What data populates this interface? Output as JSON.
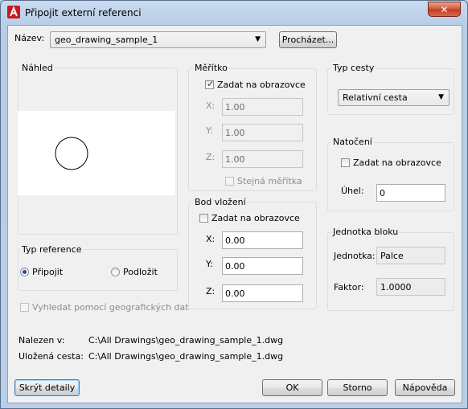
{
  "window": {
    "title": "Připojit externí referenci"
  },
  "name_row": {
    "label": "Název:",
    "value": "geo_drawing_sample_1",
    "browse_label": "Procházet..."
  },
  "preview": {
    "label": "Náhled"
  },
  "reference_type": {
    "label": "Typ reference",
    "attach_label": "Připojit",
    "overlay_label": "Podložit",
    "attach_selected": true
  },
  "geo_locate": {
    "label": "Vyhledat pomocí geografických dat",
    "checked": false
  },
  "scale": {
    "label": "Měřítko",
    "specify_label": "Zadat na obrazovce",
    "specify_checked": true,
    "x_label": "X:",
    "x_value": "1.00",
    "y_label": "Y:",
    "y_value": "1.00",
    "z_label": "Z:",
    "z_value": "1.00",
    "uniform_label": "Stejná měřítka",
    "uniform_checked": false
  },
  "insertion": {
    "label": "Bod vložení",
    "specify_label": "Zadat na obrazovce",
    "specify_checked": false,
    "x_label": "X:",
    "x_value": "0.00",
    "y_label": "Y:",
    "y_value": "0.00",
    "z_label": "Z:",
    "z_value": "0.00"
  },
  "path_type": {
    "label": "Typ cesty",
    "value": "Relativní cesta"
  },
  "rotation": {
    "label": "Natočení",
    "specify_label": "Zadat na obrazovce",
    "specify_checked": false,
    "angle_label": "Úhel:",
    "angle_value": "0"
  },
  "block_unit": {
    "label": "Jednotka bloku",
    "unit_label": "Jednotka:",
    "unit_value": "Palce",
    "factor_label": "Faktor:",
    "factor_value": "1.0000"
  },
  "details": {
    "found_label": "Nalezen v:",
    "found_value": "C:\\All Drawings\\geo_drawing_sample_1.dwg",
    "saved_label": "Uložená cesta:",
    "saved_value": "C:\\All Drawings\\geo_drawing_sample_1.dwg"
  },
  "buttons": {
    "hide_details": "Skrýt detaily",
    "ok": "OK",
    "cancel": "Storno",
    "help": "Nápověda"
  },
  "colors": {
    "title_bar": "#b9cee7",
    "client_bg": "#f0f0f0",
    "close": "#c23d1f",
    "app_icon": "#c8191c"
  }
}
